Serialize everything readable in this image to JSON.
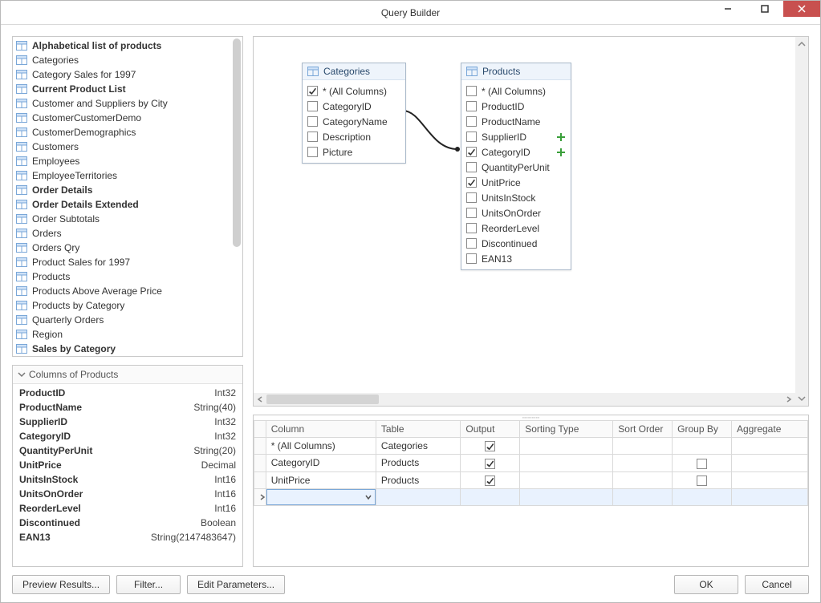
{
  "window": {
    "title": "Query Builder"
  },
  "tables": [
    {
      "name": "Alphabetical list of products",
      "bold": true
    },
    {
      "name": "Categories",
      "bold": false
    },
    {
      "name": "Category Sales for 1997",
      "bold": false
    },
    {
      "name": "Current Product List",
      "bold": true
    },
    {
      "name": "Customer and Suppliers by City",
      "bold": false
    },
    {
      "name": "CustomerCustomerDemo",
      "bold": false
    },
    {
      "name": "CustomerDemographics",
      "bold": false
    },
    {
      "name": "Customers",
      "bold": false
    },
    {
      "name": "Employees",
      "bold": false
    },
    {
      "name": "EmployeeTerritories",
      "bold": false
    },
    {
      "name": "Order Details",
      "bold": true
    },
    {
      "name": "Order Details Extended",
      "bold": true
    },
    {
      "name": "Order Subtotals",
      "bold": false
    },
    {
      "name": "Orders",
      "bold": false
    },
    {
      "name": "Orders Qry",
      "bold": false
    },
    {
      "name": "Product Sales for 1997",
      "bold": false
    },
    {
      "name": "Products",
      "bold": false
    },
    {
      "name": "Products Above Average Price",
      "bold": false
    },
    {
      "name": "Products by Category",
      "bold": false
    },
    {
      "name": "Quarterly Orders",
      "bold": false
    },
    {
      "name": "Region",
      "bold": false
    },
    {
      "name": "Sales by Category",
      "bold": true
    }
  ],
  "columns_panel": {
    "header": "Columns of Products",
    "rows": [
      {
        "name": "ProductID",
        "type": "Int32"
      },
      {
        "name": "ProductName",
        "type": "String(40)"
      },
      {
        "name": "SupplierID",
        "type": "Int32"
      },
      {
        "name": "CategoryID",
        "type": "Int32"
      },
      {
        "name": "QuantityPerUnit",
        "type": "String(20)"
      },
      {
        "name": "UnitPrice",
        "type": "Decimal"
      },
      {
        "name": "UnitsInStock",
        "type": "Int16"
      },
      {
        "name": "UnitsOnOrder",
        "type": "Int16"
      },
      {
        "name": "ReorderLevel",
        "type": "Int16"
      },
      {
        "name": "Discontinued",
        "type": "Boolean"
      },
      {
        "name": "EAN13",
        "type": "String(2147483647)"
      }
    ]
  },
  "design": {
    "categories": {
      "title": "Categories",
      "cols": [
        {
          "name": "* (All Columns)",
          "checked": true
        },
        {
          "name": "CategoryID",
          "checked": false
        },
        {
          "name": "CategoryName",
          "checked": false
        },
        {
          "name": "Description",
          "checked": false
        },
        {
          "name": "Picture",
          "checked": false
        }
      ]
    },
    "products": {
      "title": "Products",
      "cols": [
        {
          "name": "* (All Columns)",
          "checked": false
        },
        {
          "name": "ProductID",
          "checked": false
        },
        {
          "name": "ProductName",
          "checked": false
        },
        {
          "name": "SupplierID",
          "checked": false,
          "plus": true
        },
        {
          "name": "CategoryID",
          "checked": true,
          "plus": true
        },
        {
          "name": "QuantityPerUnit",
          "checked": false
        },
        {
          "name": "UnitPrice",
          "checked": true
        },
        {
          "name": "UnitsInStock",
          "checked": false
        },
        {
          "name": "UnitsOnOrder",
          "checked": false
        },
        {
          "name": "ReorderLevel",
          "checked": false
        },
        {
          "name": "Discontinued",
          "checked": false
        },
        {
          "name": "EAN13",
          "checked": false
        }
      ]
    }
  },
  "grid": {
    "headers": [
      "Column",
      "Table",
      "Output",
      "Sorting Type",
      "Sort Order",
      "Group By",
      "Aggregate"
    ],
    "rows": [
      {
        "column": "* (All Columns)",
        "table": "Categories",
        "output": true,
        "groupby": null
      },
      {
        "column": "CategoryID",
        "table": "Products",
        "output": true,
        "groupby": false
      },
      {
        "column": "UnitPrice",
        "table": "Products",
        "output": true,
        "groupby": false
      }
    ]
  },
  "footer": {
    "preview": "Preview Results...",
    "filter": "Filter...",
    "edit_params": "Edit Parameters...",
    "ok": "OK",
    "cancel": "Cancel"
  }
}
